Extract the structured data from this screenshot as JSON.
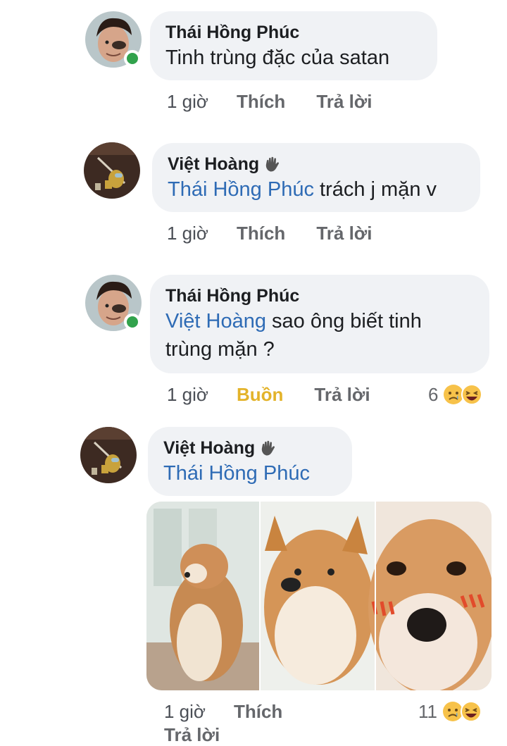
{
  "comments": [
    {
      "author": "Thái Hồng Phúc",
      "body": "Tinh trùng đặc của satan",
      "time": "1 giờ",
      "like": "Thích",
      "reply": "Trả lời"
    },
    {
      "author": "Việt Hoàng",
      "mention": "Thái Hồng Phúc",
      "body": " trách j mặn v",
      "time": "1 giờ",
      "like": "Thích",
      "reply": "Trả lời"
    },
    {
      "author": "Thái Hồng Phúc",
      "mention": "Việt Hoàng",
      "body": " sao ông biết tinh trùng mặn ?",
      "time": "1 giờ",
      "reaction_label": "Buồn",
      "reply": "Trả lời",
      "reaction_count": "6"
    },
    {
      "author": "Việt Hoàng",
      "mention": "Thái Hồng Phúc",
      "time": "1 giờ",
      "like": "Thích",
      "reply": "Trả lời",
      "reaction_count": "11"
    }
  ],
  "colors": {
    "bubble": "#f0f2f5",
    "mention": "#2e6bb5",
    "sad_reaction": "#e3b32a",
    "online": "#31a24c"
  },
  "icons": [
    "wave-hand-icon",
    "sad-emoji-icon",
    "haha-emoji-icon"
  ]
}
